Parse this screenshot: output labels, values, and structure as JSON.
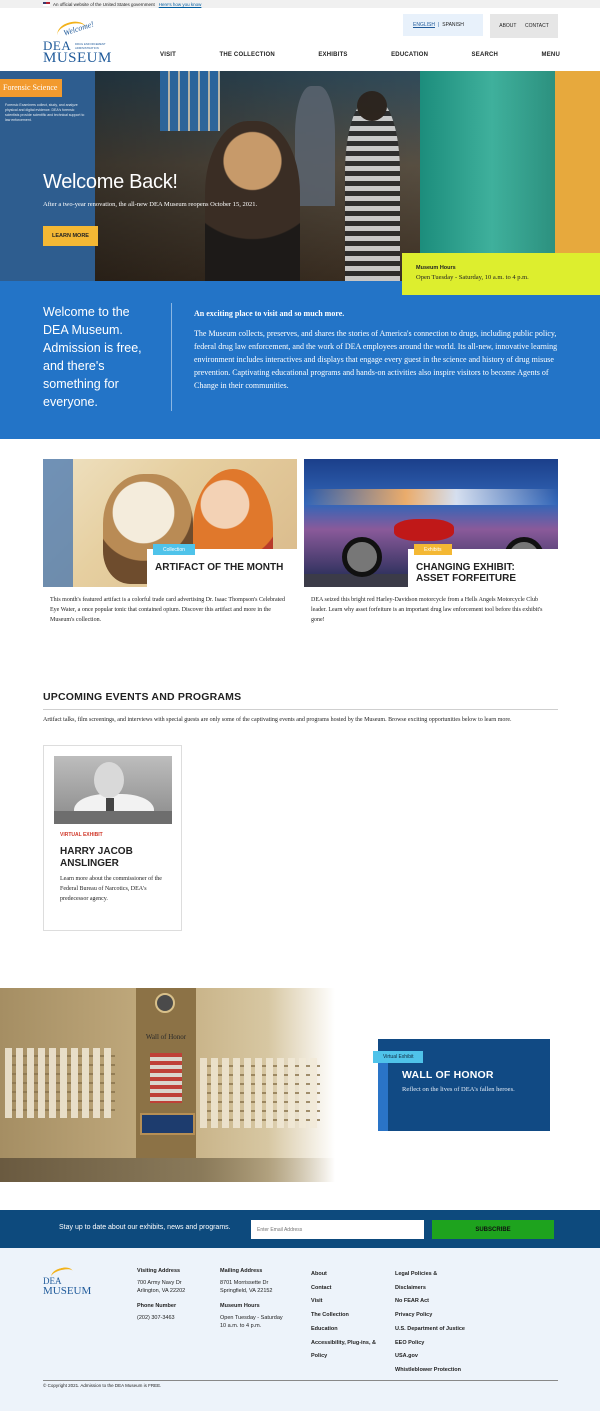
{
  "gov_banner": {
    "text": "An official website of the United States government",
    "link": "Here's how you know"
  },
  "logo": {
    "welcome": "Welcome!",
    "dea": "DEA",
    "museum": "MUSEUM",
    "sub": "DRUG ENFORCEMENT ADMINISTRATION"
  },
  "lang": {
    "english": "ENGLISH",
    "sep": "|",
    "spanish": "SPANISH"
  },
  "utility": {
    "about": "ABOUT",
    "contact": "CONTACT"
  },
  "nav": [
    "VISIT",
    "THE COLLECTION",
    "EXHIBITS",
    "EDUCATION",
    "SEARCH",
    "MENU"
  ],
  "hero": {
    "panel_title": "Forensic Science",
    "panel_text": "Forensic Examiners collect, study, and analyze physical and digital evidence. DEA's forensic scientists provide scientific and technical support to law enforcement.",
    "title": "Welcome Back!",
    "subtitle": "After a two-year renovation, the all-new DEA Museum reopens October 15, 2021.",
    "button": "LEARN MORE"
  },
  "hours": {
    "title": "Museum Hours",
    "value": "Open Tuesday - Saturday, 10 a.m. to 4 p.m."
  },
  "welcome": {
    "left": "Welcome to the DEA Museum. Admission is free, and there's something for everyone.",
    "title": "An exciting place to visit and so much more.",
    "body": "The Museum collects, preserves, and shares the stories of America's connection to drugs, including public policy, federal drug law enforcement, and the work of DEA employees around the world. Its all-new, innovative learning environment includes interactives and displays that engage every guest in the science and history of drug misuse prevention. Captivating educational programs and hands-on activities also inspire visitors to become Agents of Change in their communities."
  },
  "cards": [
    {
      "tag": "Collection",
      "title": "ARTIFACT OF THE MONTH",
      "desc": "This month's featured artifact is a colorful trade card advertising Dr. Isaac Thompson's Celebrated Eye Water, a once popular tonic that contained opium. Discover this artifact and more in the Museum's collection."
    },
    {
      "tag": "Exhibits",
      "title": "CHANGING EXHIBIT: ASSET FORFEITURE",
      "desc": "DEA seized this bright red Harley-Davidson motorcycle from a Hells Angels Motorcycle Club leader. Learn why asset forfeiture is an important drug law enforcement tool before this exhibit's gone!"
    }
  ],
  "events": {
    "heading": "UPCOMING EVENTS AND PROGRAMS",
    "intro": "Artifact talks, film screenings, and interviews with special guests are only some of the captivating events and programs hosted by the Museum. Browse exciting opportunities below to learn more.",
    "card": {
      "tag": "VIRTUAL EXHIBIT",
      "name": "HARRY JACOB ANSLINGER",
      "desc": "Learn more about the commissioner of the Federal Bureau of Narcotics, DEA's predecessor agency."
    }
  },
  "honor": {
    "wall_text": "Wall of Honor",
    "tag": "Virtual Exhibit",
    "title": "WALL OF HONOR",
    "desc": "Reflect on the lives of DEA's fallen heroes."
  },
  "newsletter": {
    "text": "Stay up to date about our exhibits, news and programs.",
    "placeholder": "Enter Email Address",
    "button": "SUBSCRIBE"
  },
  "footer": {
    "visiting_h": "Visiting Address",
    "visiting_1": "700 Army Navy Dr",
    "visiting_2": "Arlington, VA 22202",
    "phone_h": "Phone Number",
    "phone": "(202) 307-3463",
    "mailing_h": "Mailing Address",
    "mailing_1": "8701 Morrissette Dr",
    "mailing_2": "Springfield, VA 22152",
    "hours_h": "Museum Hours",
    "hours_1": "Open Tuesday - Saturday",
    "hours_2": "10 a.m. to 4 p.m.",
    "links1": [
      "About",
      "Contact",
      "Visit",
      "The Collection",
      "Education",
      "Accessibility, Plug-ins, &",
      "Policy"
    ],
    "links2": [
      "Legal Policies &",
      "Disclaimers",
      "No FEAR Act",
      "Privacy Policy",
      "U.S. Department of Justice",
      "EEO Policy",
      "USA.gov",
      "Whistleblower Protection"
    ],
    "copyright": "© Copyright 2021. Admission to the DEA Museum is FREE."
  },
  "colors": {
    "brand_blue": "#2374c7",
    "dark_blue": "#0d4a7d",
    "accent_yellow": "#f4b834",
    "hours_yellow": "#ddee2e",
    "subscribe_green": "#1ea31e",
    "collection_tag": "#4fc3ea",
    "exhibits_tag": "#f4b834"
  }
}
